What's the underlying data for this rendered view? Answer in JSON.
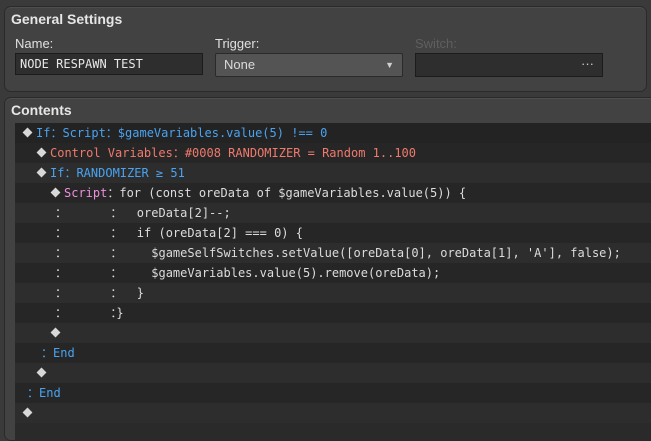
{
  "general": {
    "title": "General Settings",
    "name_label": "Name:",
    "name_value": "NODE RESPAWN TEST",
    "trigger_label": "Trigger:",
    "trigger_value": "None",
    "switch_label": "Switch:",
    "switch_button": "···",
    "arrow_icon": "▼"
  },
  "contents": {
    "title": "Contents",
    "rows": [
      [
        {
          "t": "If",
          "c": "blue"
        },
        {
          "t": "：Script：$gameVariables.value(5) !== 0",
          "c": "blue"
        }
      ],
      [
        {
          "t": "Control Variables：#0008 RANDOMIZER = Random 1..100",
          "c": "red"
        }
      ],
      [
        {
          "t": "If：RANDOMIZER ≥ 51",
          "c": "blue"
        }
      ],
      [
        {
          "t": "Script",
          "c": "pink"
        },
        {
          "t": "：for (const oreData of $gameVariables.value(5)) {",
          "c": "text"
        }
      ],
      [
        {
          "t": "：      ：  oreData[2]--;",
          "c": "text"
        }
      ],
      [
        {
          "t": "：      ：  if (oreData[2] === 0) {",
          "c": "text"
        }
      ],
      [
        {
          "t": "：      ：    $gameSelfSwitches.setValue([oreData[0], oreData[1], 'A'], false);",
          "c": "text"
        }
      ],
      [
        {
          "t": "：      ：    $gameVariables.value(5).remove(oreData);",
          "c": "text"
        }
      ],
      [
        {
          "t": "：      ：  }",
          "c": "text"
        }
      ],
      [
        {
          "t": "：      ：}",
          "c": "text"
        }
      ],
      [],
      [
        {
          "t": "：End",
          "c": "blue"
        }
      ],
      [],
      [
        {
          "t": "：End",
          "c": "blue"
        }
      ],
      []
    ]
  }
}
